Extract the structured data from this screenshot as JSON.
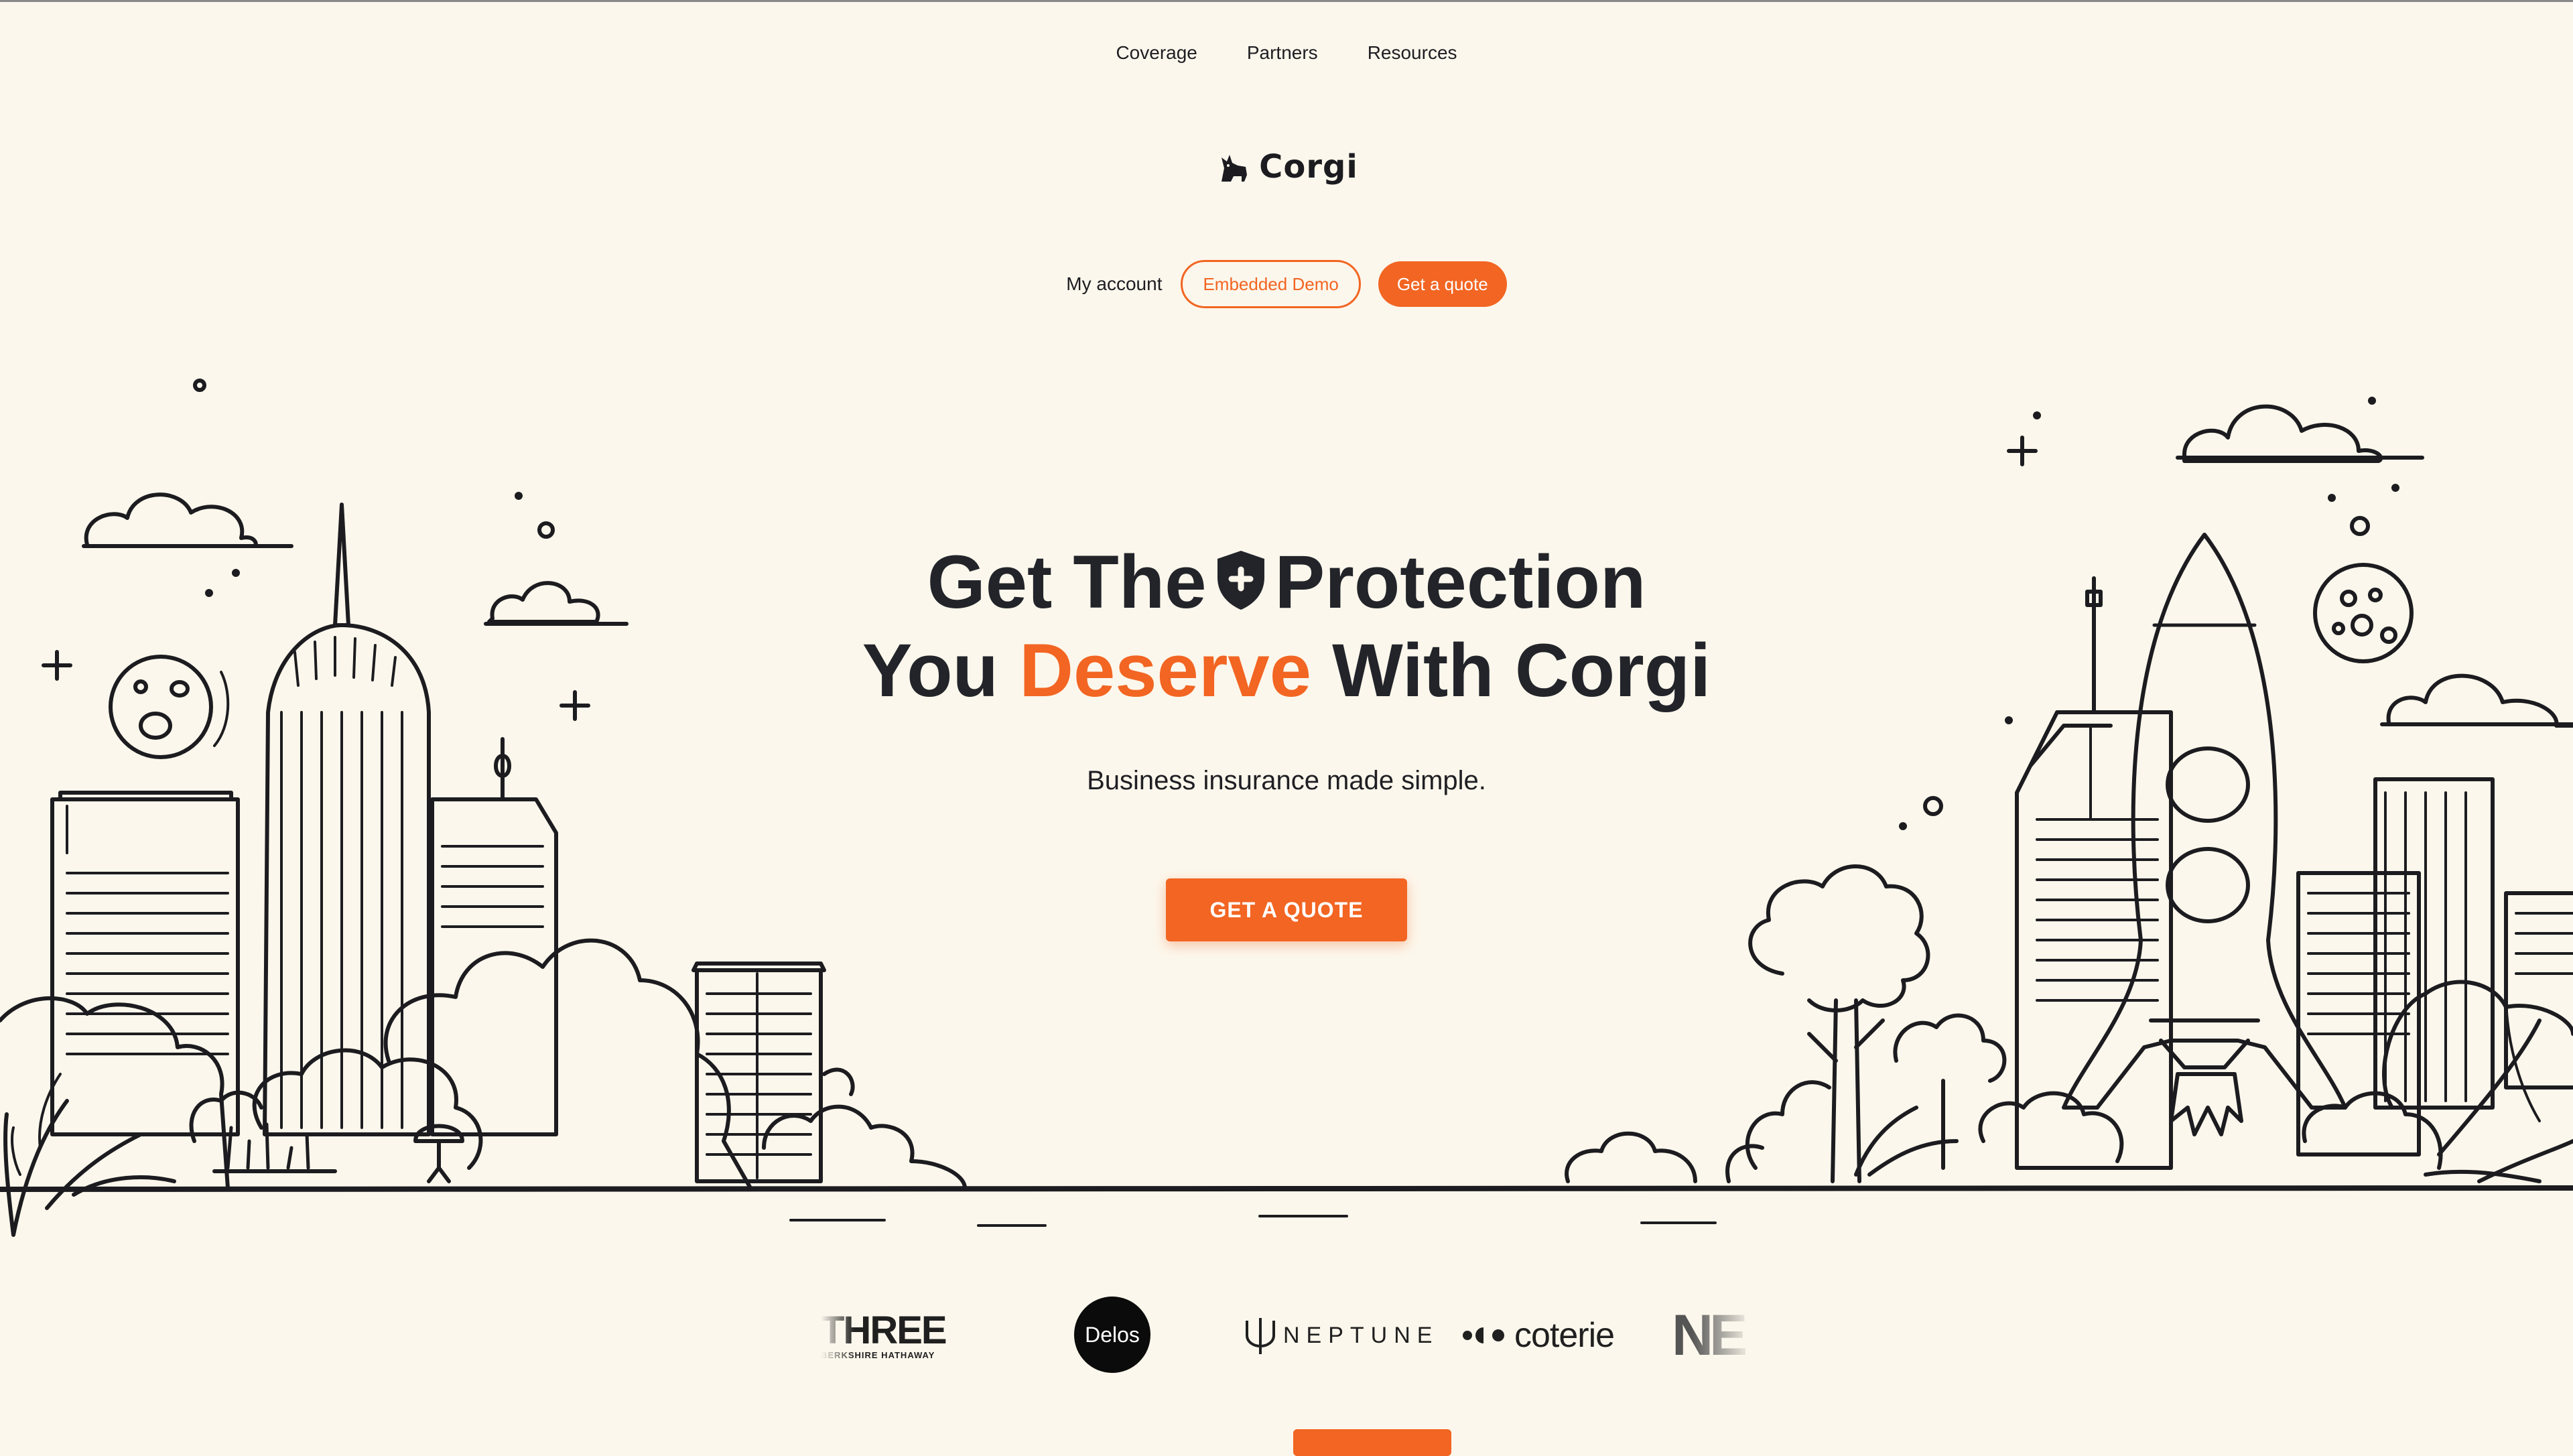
{
  "nav": {
    "links": [
      "Coverage",
      "Partners",
      "Resources"
    ]
  },
  "brand": {
    "name": "Corgi"
  },
  "header_actions": {
    "account": "My account",
    "demo": "Embedded Demo",
    "quote": "Get a quote"
  },
  "hero": {
    "title_line1_a": "Get The",
    "title_line1_b": "Protection",
    "title_line2_a": "You",
    "title_line2_highlight": "Deserve",
    "title_line2_b": "With Corgi",
    "subtitle": "Business insurance made simple.",
    "cta": "GET A QUOTE"
  },
  "partners": {
    "three_big": "THREE",
    "three_small": "BERKSHIRE HATHAWAY",
    "delos": "Delos",
    "neptune": "NEPTUNE",
    "coterie": "coterie",
    "ne": "NE"
  },
  "colors": {
    "accent": "#f26522",
    "background": "#fcf7ec",
    "ink": "#1f1f24"
  },
  "icons": [
    "corgi-logo-icon",
    "shield-plus-icon",
    "neptune-trident-icon",
    "coterie-dots-icon"
  ]
}
